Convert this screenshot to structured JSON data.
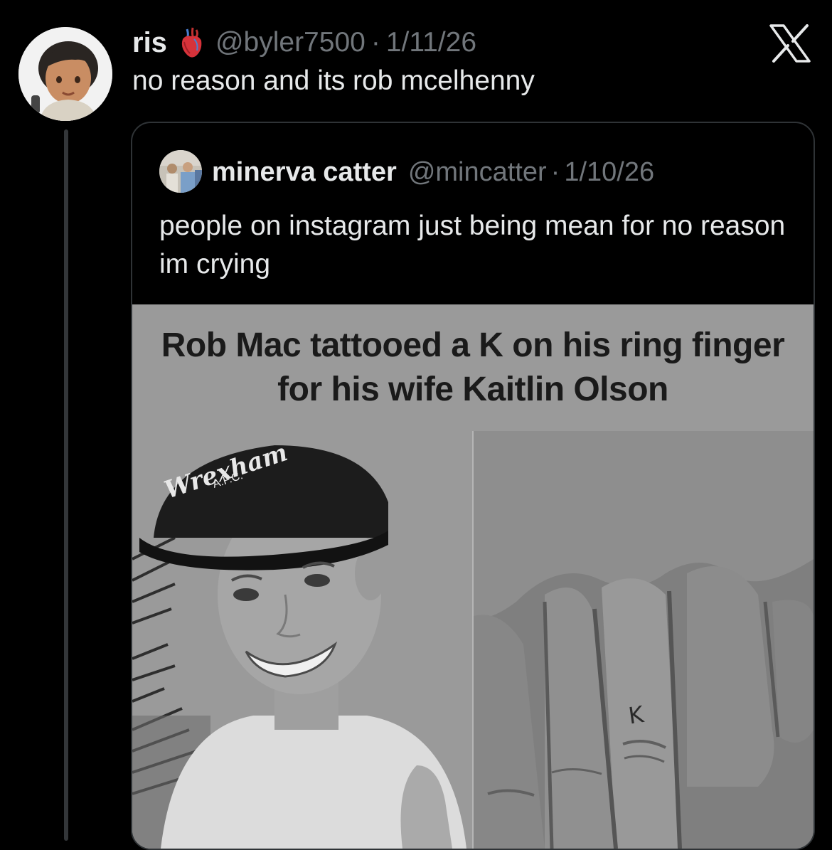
{
  "tweet": {
    "display_name": "ris",
    "handle": "@byler7500",
    "separator": "·",
    "date": "1/11/26",
    "text": "no reason and its rob mcelhenny",
    "badge_icon": "anatomical-heart-icon",
    "close_icon": "x-logo-icon"
  },
  "quote": {
    "display_name": "minerva catter",
    "handle": "@mincatter",
    "separator": "·",
    "date": "1/10/26",
    "text": "people on instagram just being mean for no reason im crying",
    "media": {
      "headline": "Rob Mac tattooed a K on his ring finger for his wife Kaitlin Olson",
      "cap_text": "Wrexham",
      "cap_subtext": "A.F.C.",
      "tattoo_letter": "K"
    }
  },
  "colors": {
    "background": "#000000",
    "primary_text": "#e7e9ea",
    "secondary_text": "#71767b",
    "border": "#2f3336"
  }
}
